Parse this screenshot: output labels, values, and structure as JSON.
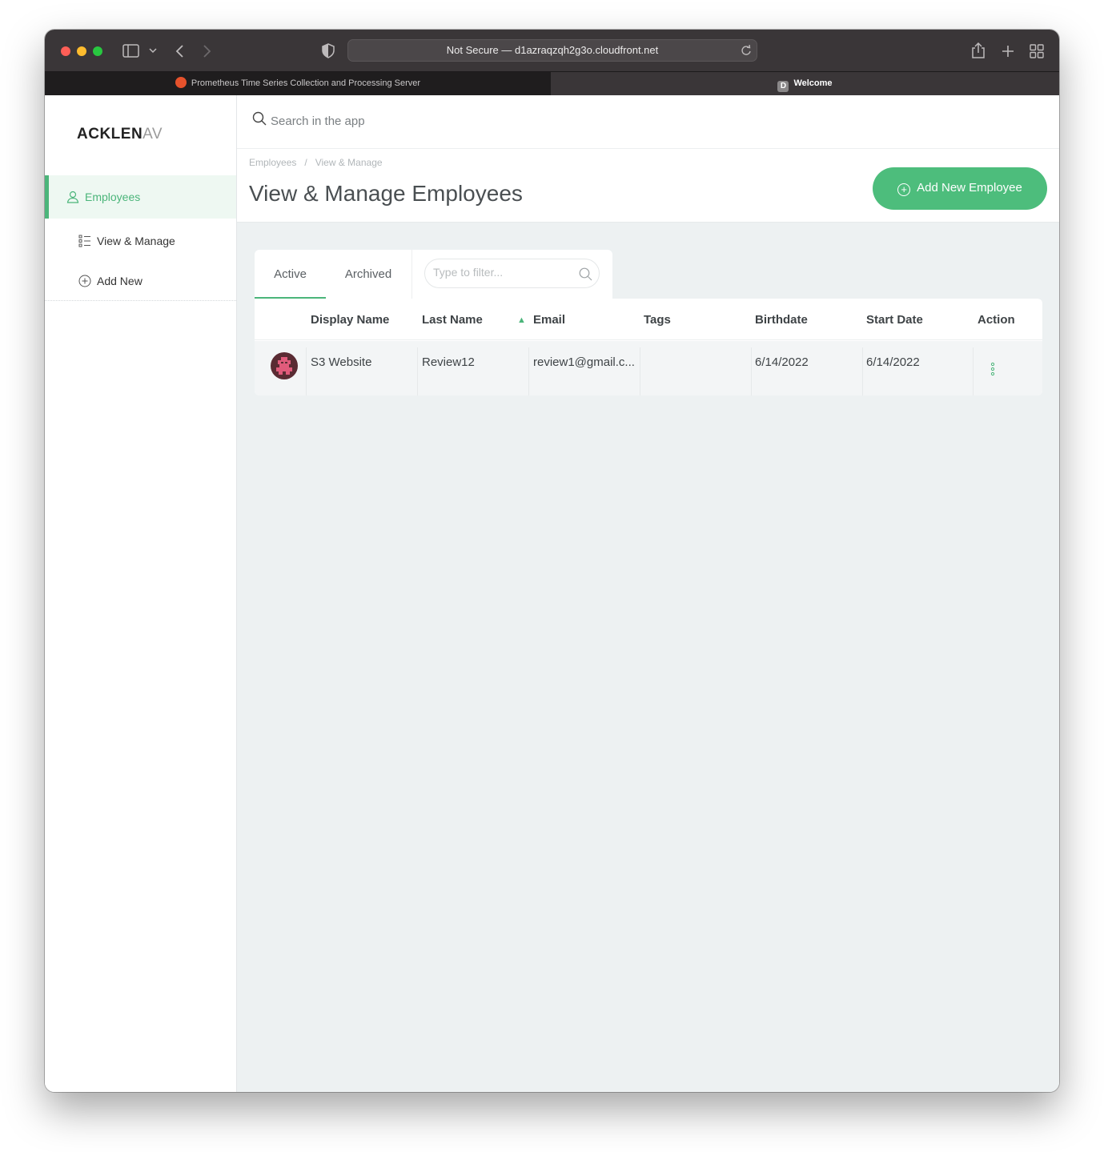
{
  "browser": {
    "url_text": "Not Secure — d1azraqzqh2g3o.cloudfront.net",
    "tabs": [
      {
        "label": "Prometheus Time Series Collection and Processing Server",
        "favicon": "prometheus-icon"
      },
      {
        "label": "Welcome",
        "favicon_letter": "D"
      }
    ]
  },
  "app": {
    "logo_main": "ACKLEN",
    "logo_fade": "AV",
    "search_placeholder": "Search in the app"
  },
  "sidebar": {
    "items": [
      {
        "label": "Employees",
        "icon": "user-icon",
        "active": true
      },
      {
        "label": "View & Manage",
        "icon": "list-icon"
      },
      {
        "label": "Add New",
        "icon": "plus-circle-icon"
      }
    ]
  },
  "header": {
    "breadcrumb": [
      "Employees",
      "/",
      "View & Manage"
    ],
    "title": "View & Manage Employees",
    "add_button": "Add New Employee"
  },
  "tabs": {
    "active_label": "Active",
    "archived_label": "Archived",
    "filter_placeholder": "Type to filter..."
  },
  "table": {
    "columns": [
      "Display Name",
      "Last Name",
      "Email",
      "Tags",
      "Birthdate",
      "Start Date",
      "Action"
    ],
    "sort_indicator": "▲",
    "rows": [
      {
        "display_name": "S3 Website",
        "last_name": "Review12",
        "email": "review1@gmail.c...",
        "tags": "",
        "birthdate": "6/14/2022",
        "start_date": "6/14/2022"
      }
    ]
  },
  "colors": {
    "accent": "#4bb57a",
    "button": "#4dbd7c",
    "background": "#edf1f2"
  }
}
